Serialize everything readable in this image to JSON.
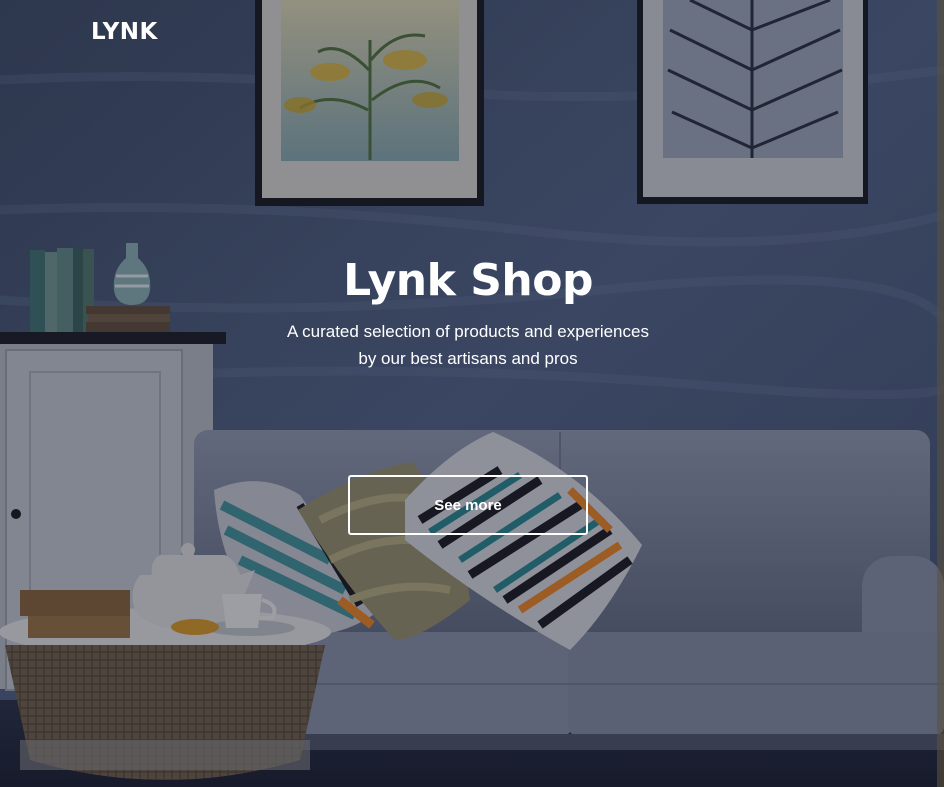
{
  "header": {
    "logo": "LYNK"
  },
  "hero": {
    "title": "Lynk Shop",
    "subtitle_line1": "A curated selection of products and experiences",
    "subtitle_line2": "by our best artisans and pros",
    "cta_label": "See more"
  },
  "colors": {
    "overlay_text": "#ffffff",
    "wall": "#4a5878",
    "sofa": "#7c8396",
    "cabinet": "#9ea3ad",
    "accent_teal": "#2a7c84",
    "accent_orange": "#d57a25"
  }
}
